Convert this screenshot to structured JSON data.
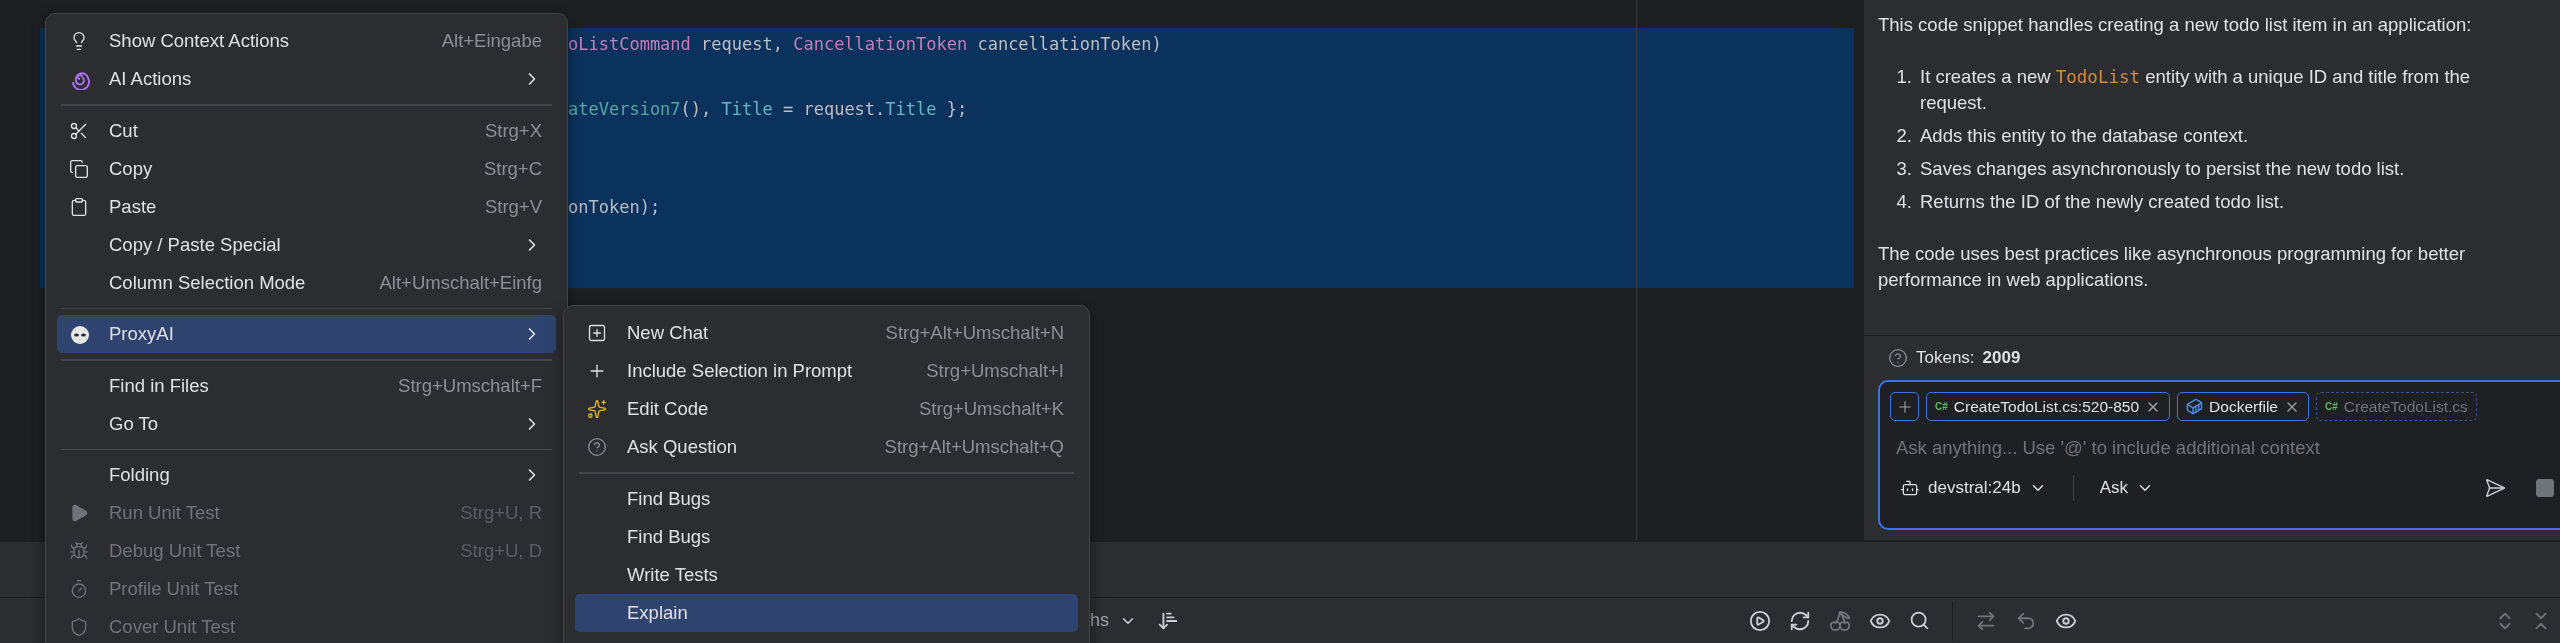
{
  "editor": {
    "code_lines": [
      [
        {
          "text": "oListCommand",
          "kind": "type"
        },
        {
          "text": " request, ",
          "kind": "plain"
        },
        {
          "text": "CancellationToken",
          "kind": "type"
        },
        {
          "text": " cancellationToken)",
          "kind": "plain"
        }
      ],
      [
        {
          "text": "ateVersion7",
          "kind": "method"
        },
        {
          "text": "(), ",
          "kind": "plain"
        },
        {
          "text": "Title",
          "kind": "property"
        },
        {
          "text": " = request.",
          "kind": "plain"
        },
        {
          "text": "Title",
          "kind": "property"
        },
        {
          "text": " };",
          "kind": "plain"
        }
      ],
      [
        {
          "text": "onToken);",
          "kind": "plain"
        }
      ]
    ]
  },
  "context_menu": {
    "groups": [
      [
        {
          "label": "Show Context Actions",
          "shortcut": "Alt+Eingabe",
          "submenu": false,
          "disabled": false,
          "selected": false
        },
        {
          "label": "AI Actions",
          "submenu": true,
          "disabled": false,
          "selected": false
        }
      ],
      [
        {
          "label": "Cut",
          "shortcut": "Strg+X",
          "submenu": false,
          "disabled": false,
          "selected": false
        },
        {
          "label": "Copy",
          "shortcut": "Strg+C",
          "submenu": false,
          "disabled": false,
          "selected": false
        },
        {
          "label": "Paste",
          "shortcut": "Strg+V",
          "submenu": false,
          "disabled": false,
          "selected": false
        },
        {
          "label": "Copy / Paste Special",
          "submenu": true,
          "disabled": false,
          "selected": false
        },
        {
          "label": "Column Selection Mode",
          "shortcut": "Alt+Umschalt+Einfg",
          "submenu": false,
          "disabled": false,
          "selected": false
        }
      ],
      [
        {
          "label": "ProxyAI",
          "submenu": true,
          "disabled": false,
          "selected": true
        }
      ],
      [
        {
          "label": "Find in Files",
          "shortcut": "Strg+Umschalt+F",
          "submenu": false,
          "disabled": false,
          "selected": false
        },
        {
          "label": "Go To",
          "submenu": true,
          "disabled": false,
          "selected": false
        }
      ],
      [
        {
          "label": "Folding",
          "submenu": true,
          "disabled": false,
          "selected": false
        },
        {
          "label": "Run Unit Test",
          "shortcut": "Strg+U, R",
          "submenu": false,
          "disabled": true,
          "selected": false
        },
        {
          "label": "Debug Unit Test",
          "shortcut": "Strg+U, D",
          "submenu": false,
          "disabled": true,
          "selected": false
        },
        {
          "label": "Profile Unit Test",
          "submenu": false,
          "disabled": true,
          "selected": false
        },
        {
          "label": "Cover Unit Test",
          "submenu": false,
          "disabled": true,
          "selected": false
        }
      ]
    ]
  },
  "proxyai_menu": {
    "groups": [
      [
        {
          "label": "New Chat",
          "shortcut": "Strg+Alt+Umschalt+N",
          "selected": false
        },
        {
          "label": "Include Selection in Prompt",
          "shortcut": "Strg+Umschalt+I",
          "selected": false
        },
        {
          "label": "Edit Code",
          "shortcut": "Strg+Umschalt+K",
          "selected": false
        },
        {
          "label": "Ask Question",
          "shortcut": "Strg+Alt+Umschalt+Q",
          "selected": false
        }
      ],
      [
        {
          "label": "Find Bugs",
          "selected": false
        },
        {
          "label": "Find Bugs",
          "selected": false
        },
        {
          "label": "Write Tests",
          "selected": false
        },
        {
          "label": "Explain",
          "selected": true
        }
      ]
    ]
  },
  "chat": {
    "intro": "This code snippet handles creating a new todo list item in an application:",
    "steps": [
      {
        "number": "1.",
        "segments": [
          {
            "text": "It creates a new ",
            "kind": "plain"
          },
          {
            "text": "TodoList",
            "kind": "code"
          },
          {
            "text": " entity with a unique ID and title from the request.",
            "kind": "plain"
          }
        ]
      },
      {
        "number": "2.",
        "segments": [
          {
            "text": "Adds this entity to the database context.",
            "kind": "plain"
          }
        ]
      },
      {
        "number": "3.",
        "segments": [
          {
            "text": "Saves changes asynchronously to persist the new todo list.",
            "kind": "plain"
          }
        ]
      },
      {
        "number": "4.",
        "segments": [
          {
            "text": "Returns the ID of the newly created todo list.",
            "kind": "plain"
          }
        ]
      }
    ],
    "outro": "The code uses best practices like asynchronous programming for better performance in web applications.",
    "tokens": {
      "label": "Tokens:",
      "value": "2009"
    },
    "input": {
      "chips": [
        {
          "label": "CreateTodoList.cs:520-850",
          "kind": "csharp",
          "icon_text": "C#",
          "included": true
        },
        {
          "label": "Dockerfile",
          "kind": "docker",
          "included": true
        },
        {
          "label": "CreateTodoList.cs",
          "kind": "csharp",
          "icon_text": "C#",
          "included": false
        }
      ],
      "placeholder": "Ask anything... Use '@' to include additional context",
      "model": "devstral:24b",
      "mode": "Ask"
    }
  },
  "bottom_toolbar": {
    "partial_label": "hs"
  }
}
